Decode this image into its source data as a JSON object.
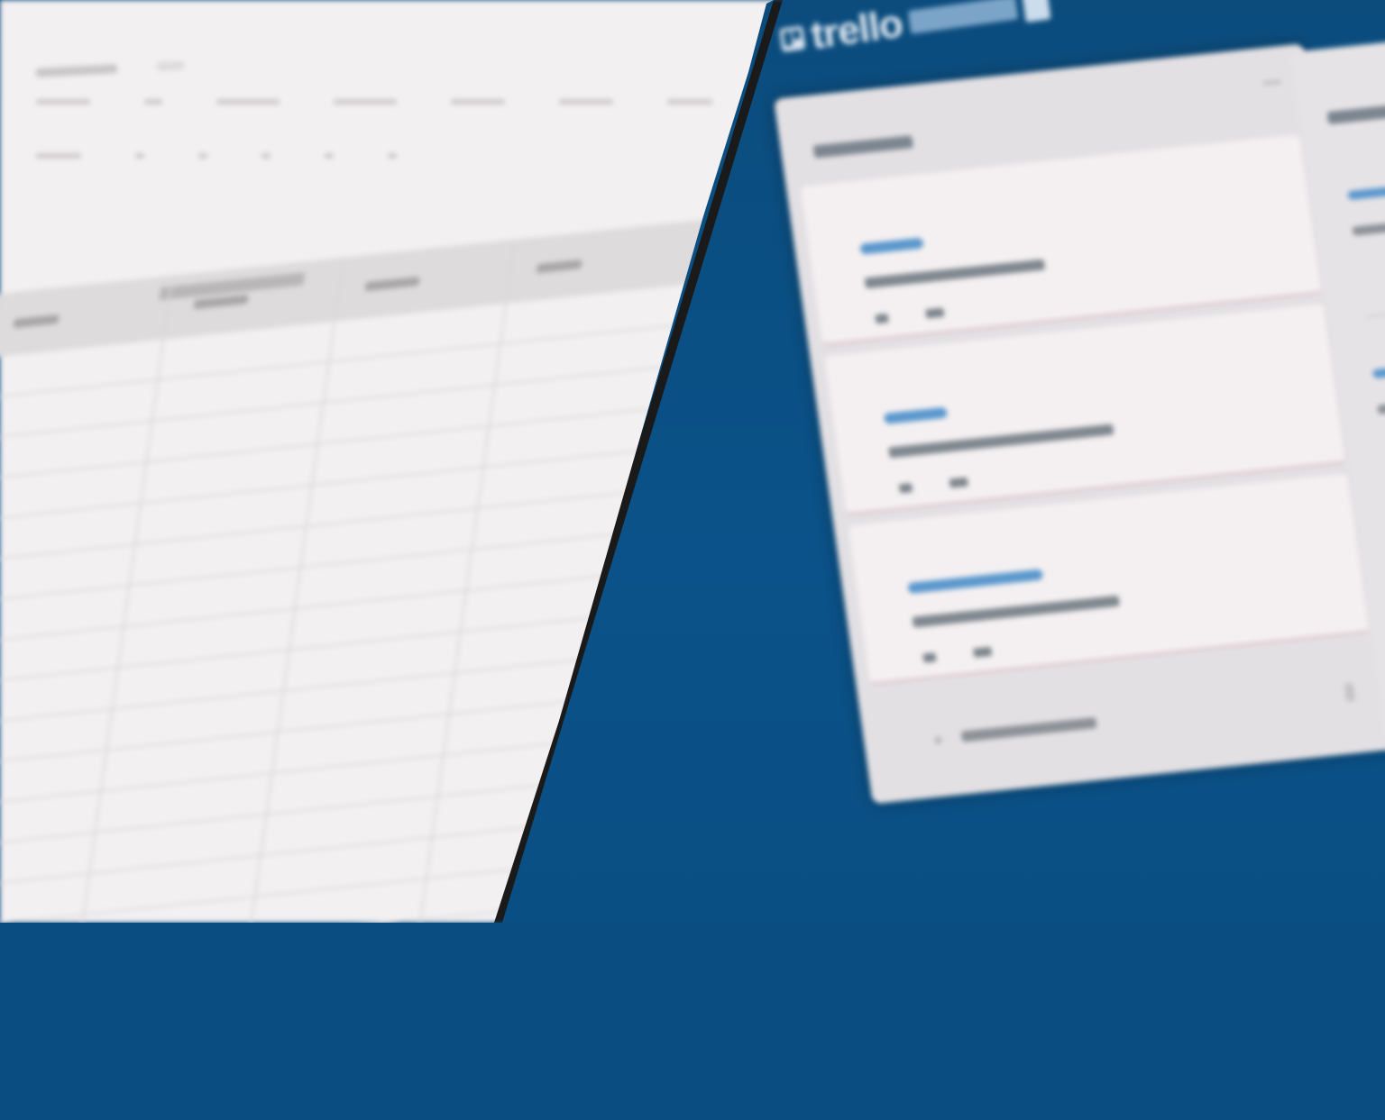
{
  "spreadsheet": {
    "column_count": 4,
    "row_count": 16
  },
  "trello": {
    "logo_text": "trello",
    "lists": [
      {
        "title": "",
        "cards": [
          {
            "label_color": "#5a97cd",
            "title": ""
          },
          {
            "label_color": "#5a97cd",
            "title": ""
          },
          {
            "label_color": "#5a97cd",
            "title": ""
          }
        ],
        "add_card_label": ""
      },
      {
        "title": "",
        "cards": [
          {
            "label_color": "#5a97cd",
            "title": ""
          },
          {
            "label_color": "#5a97cd",
            "title": ""
          }
        ]
      }
    ],
    "board_color": "#0a4d80"
  }
}
